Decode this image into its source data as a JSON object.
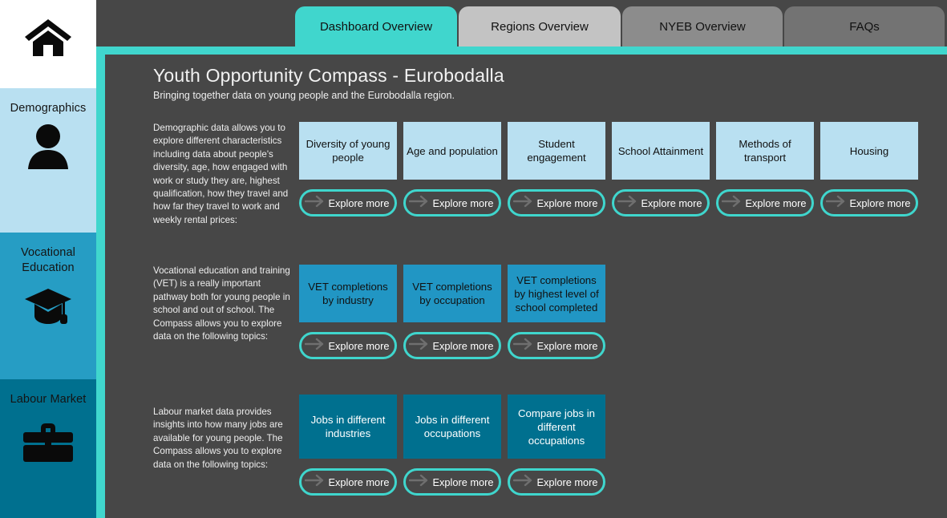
{
  "sidebar": {
    "items": [
      {
        "label": "",
        "icon": "home-icon",
        "name": "home"
      },
      {
        "label": "Demographics",
        "icon": "person-icon",
        "name": "demographics"
      },
      {
        "label": "Vocational Education",
        "icon": "graduation-cap-icon",
        "name": "vocational-education"
      },
      {
        "label": "Labour Market",
        "icon": "briefcase-icon",
        "name": "labour-market"
      }
    ],
    "labels": {
      "demographics": "Demographics",
      "vocational_line1": "Vocational",
      "vocational_line2": "Education",
      "labour": "Labour Market"
    }
  },
  "tabs": [
    {
      "label": "Dashboard Overview",
      "active": true
    },
    {
      "label": "Regions Overview",
      "active": false
    },
    {
      "label": "NYEB Overview",
      "active": false
    },
    {
      "label": "FAQs",
      "active": false
    }
  ],
  "header": {
    "title": "Youth Opportunity Compass - Eurobodalla",
    "subtitle": "Bringing together data on young people and the Eurobodalla region."
  },
  "explore_label": "Explore more",
  "sections": [
    {
      "id": "demographics",
      "description": "Demographic data allows you to explore different characteristics including data about people's diversity, age, how engaged with work or study they are, highest qualification, how they travel and how far they travel to work and weekly rental prices:",
      "cards": [
        {
          "title": "Diversity of young people",
          "button": "Explore more"
        },
        {
          "title": "Age and population",
          "button": "Explore more"
        },
        {
          "title": "Student engagement",
          "button": "Explore more"
        },
        {
          "title": "School Attainment",
          "button": "Explore more"
        },
        {
          "title": "Methods of transport",
          "button": "Explore more"
        },
        {
          "title": "Housing",
          "button": "Explore more"
        }
      ]
    },
    {
      "id": "vocational-education",
      "description": "Vocational education and training (VET) is a really important pathway both for young people in school and out of school. The Compass allows you to explore data on the following topics:",
      "cards": [
        {
          "title": "VET completions by industry",
          "button": "Explore more"
        },
        {
          "title": "VET completions by occupation",
          "button": "Explore more"
        },
        {
          "title": "VET completions by highest level of school completed",
          "button": "Explore more"
        }
      ]
    },
    {
      "id": "labour-market",
      "description": "Labour market data provides insights into how many jobs are available for young people. The Compass allows you to explore data on the following topics:",
      "cards": [
        {
          "title": "Jobs in different industries",
          "button": "Explore more"
        },
        {
          "title": "Jobs in different occupations",
          "button": "Explore more"
        },
        {
          "title": "Compare jobs in different occupations",
          "button": "Explore more"
        }
      ]
    }
  ],
  "colors": {
    "accent_teal": "#40d6cd",
    "background_dark": "#474747",
    "demographics_blue": "#b9e0f1",
    "vocational_blue": "#2196c4",
    "labour_blue": "#00708f",
    "tab_active": "#40d6cd",
    "tab_inactive_1": "#c3c3c3",
    "tab_inactive_2": "#8c8c8c",
    "tab_inactive_3": "#737373"
  }
}
